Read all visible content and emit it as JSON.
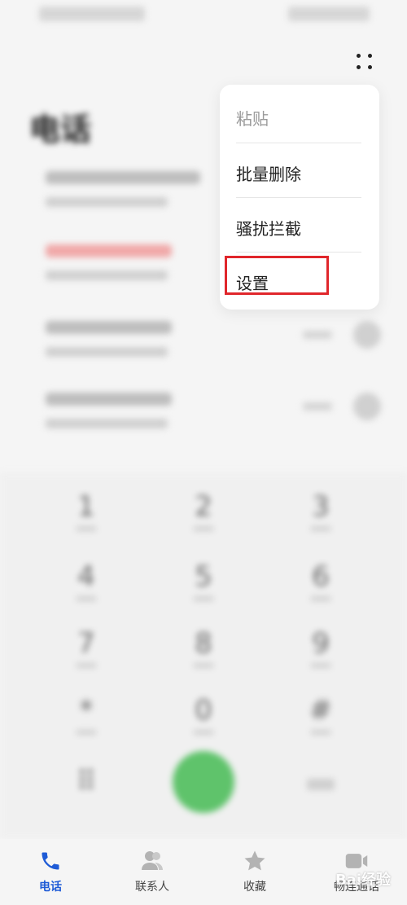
{
  "page": {
    "title": "电话"
  },
  "dialpad": {
    "keys": [
      "1",
      "2",
      "3",
      "4",
      "5",
      "6",
      "7",
      "8",
      "9",
      "*",
      "0",
      "#"
    ]
  },
  "menu": {
    "items": [
      {
        "label": "粘贴",
        "enabled": false
      },
      {
        "label": "批量删除",
        "enabled": true
      },
      {
        "label": "骚扰拦截",
        "enabled": true
      },
      {
        "label": "设置",
        "enabled": true,
        "highlighted": true
      }
    ]
  },
  "bottom_nav": {
    "items": [
      {
        "label": "电话",
        "icon": "phone-icon",
        "active": true
      },
      {
        "label": "联系人",
        "icon": "contacts-icon",
        "active": false
      },
      {
        "label": "收藏",
        "icon": "star-icon",
        "active": false
      },
      {
        "label": "畅连通话",
        "icon": "video-call-icon",
        "active": false
      }
    ]
  },
  "colors": {
    "accent": "#1e5bd6",
    "highlight": "#e0262b",
    "call_button": "#5fc36b"
  },
  "watermark": {
    "text": "Bai经验"
  }
}
